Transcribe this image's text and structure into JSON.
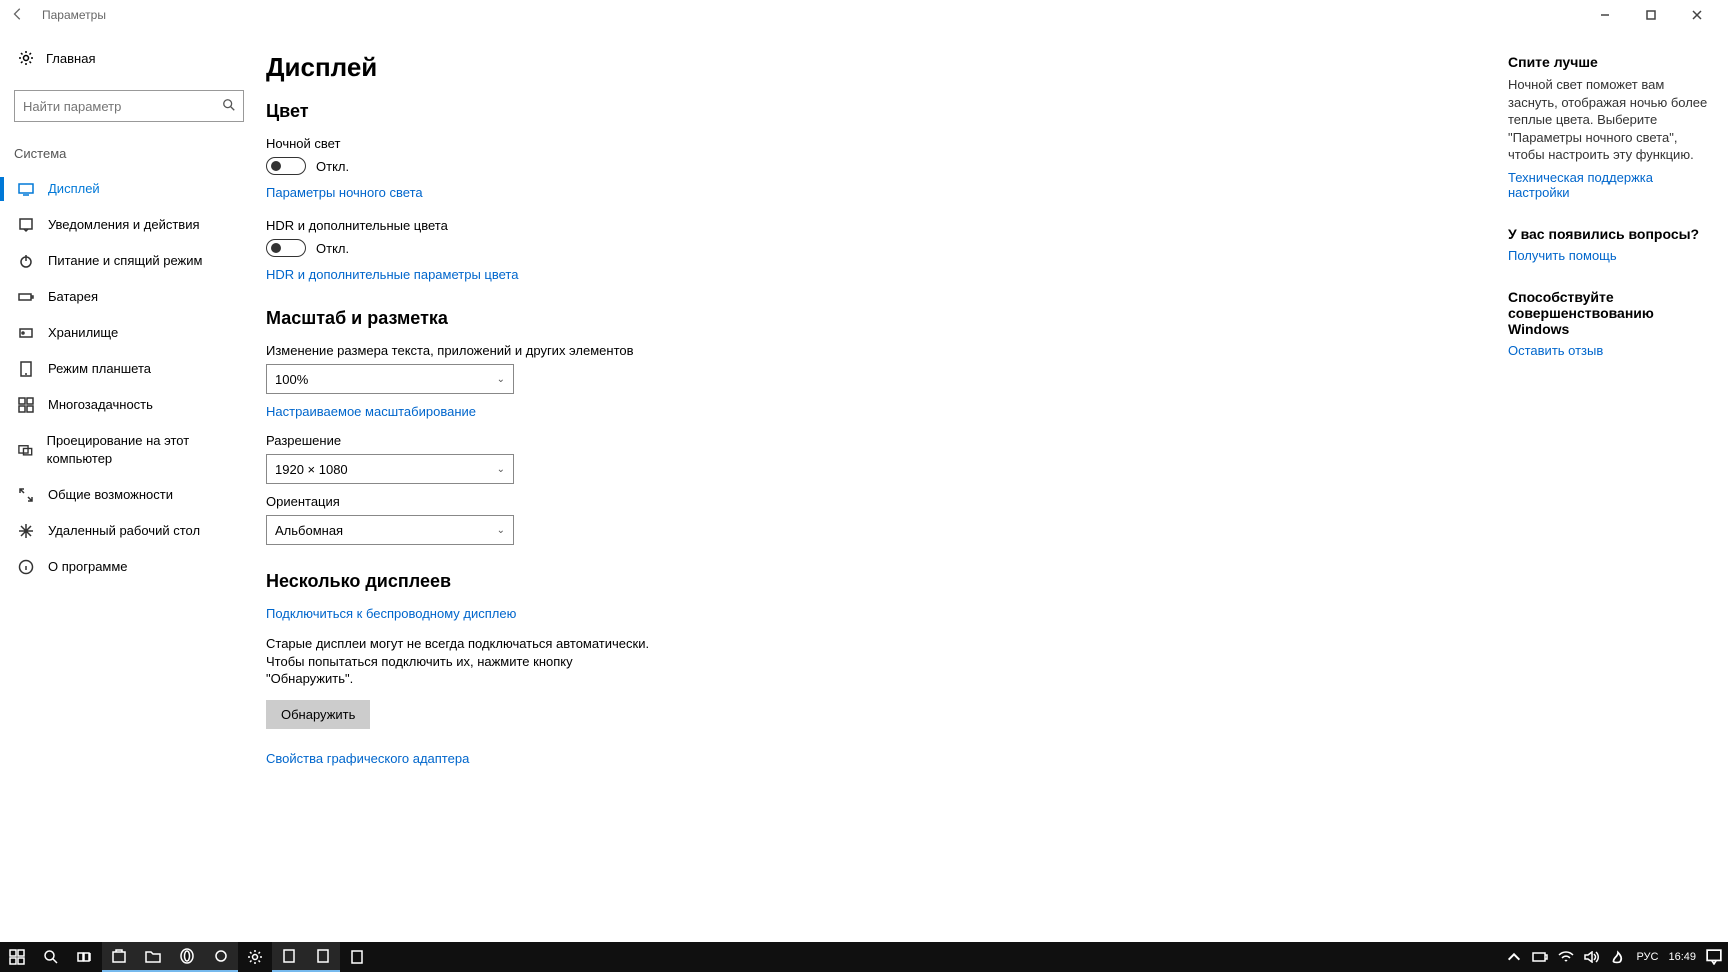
{
  "window": {
    "title": "Параметры"
  },
  "sidebar": {
    "home_label": "Главная",
    "search_placeholder": "Найти параметр",
    "group_title": "Система",
    "items": [
      {
        "label": "Дисплей",
        "icon": "display-icon",
        "active": true
      },
      {
        "label": "Уведомления и действия",
        "icon": "notification-icon"
      },
      {
        "label": "Питание и спящий режим",
        "icon": "power-icon"
      },
      {
        "label": "Батарея",
        "icon": "battery-icon"
      },
      {
        "label": "Хранилище",
        "icon": "storage-icon"
      },
      {
        "label": "Режим планшета",
        "icon": "tablet-icon"
      },
      {
        "label": "Многозадачность",
        "icon": "multitask-icon"
      },
      {
        "label": "Проецирование на этот компьютер",
        "icon": "project-icon"
      },
      {
        "label": "Общие возможности",
        "icon": "shared-icon"
      },
      {
        "label": "Удаленный рабочий стол",
        "icon": "remote-icon"
      },
      {
        "label": "О программе",
        "icon": "info-icon"
      }
    ]
  },
  "main": {
    "title": "Дисплей",
    "color": {
      "heading": "Цвет",
      "night_light_label": "Ночной свет",
      "night_light_state": "Откл.",
      "night_light_settings_link": "Параметры ночного света",
      "hdr_label": "HDR и дополнительные цвета",
      "hdr_state": "Откл.",
      "hdr_link": "HDR и дополнительные параметры цвета"
    },
    "scale": {
      "heading": "Масштаб и разметка",
      "scale_label": "Изменение размера текста, приложений и других элементов",
      "scale_value": "100%",
      "custom_scale_link": "Настраиваемое масштабирование",
      "resolution_label": "Разрешение",
      "resolution_value": "1920 × 1080",
      "orientation_label": "Ориентация",
      "orientation_value": "Альбомная"
    },
    "multi": {
      "heading": "Несколько дисплеев",
      "wireless_link": "Подключиться к беспроводному дисплею",
      "detect_text": "Старые дисплеи могут не всегда подключаться автоматически. Чтобы попытаться подключить их, нажмите кнопку \"Обнаружить\".",
      "detect_button": "Обнаружить",
      "adapter_link": "Свойства графического адаптера"
    }
  },
  "right": {
    "sleep": {
      "title": "Спите лучше",
      "desc": "Ночной свет поможет вам заснуть, отображая ночью более теплые цвета. Выберите \"Параметры ночного света\", чтобы настроить эту функцию.",
      "link": "Техническая поддержка настройки"
    },
    "questions": {
      "title": "У вас появились вопросы?",
      "link": "Получить помощь"
    },
    "improve": {
      "title": "Способствуйте совершенствованию Windows",
      "link": "Оставить отзыв"
    }
  },
  "taskbar": {
    "lang": "РУС",
    "time": "16:49"
  }
}
